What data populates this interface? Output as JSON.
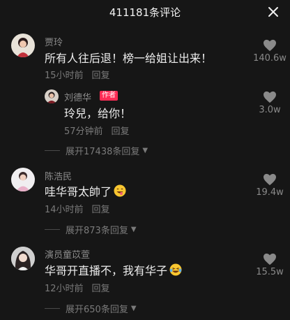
{
  "header": {
    "title": "411181条评论"
  },
  "comments": [
    {
      "username": "贾玲",
      "text": "所有人往后退！榜一给姐让出来！",
      "time": "15小时前",
      "reply_label": "回复",
      "likes": "140.6w",
      "reply": {
        "username": "刘德华",
        "author_tag": "作者",
        "text": "玲兒，给你！",
        "time": "57分钟前",
        "reply_label": "回复",
        "likes": "3.0w"
      },
      "expand_label": "展开17438条回复"
    },
    {
      "username": "陈浩民",
      "text": "哇华哥太帥了",
      "time": "14小时前",
      "reply_label": "回复",
      "likes": "19.4w",
      "expand_label": "展开873条回复"
    },
    {
      "username": "演员童苡萱",
      "text": "华哥开直播不，我有华子",
      "time": "12小时前",
      "reply_label": "回复",
      "likes": "15.5w",
      "expand_label": "展开650条回复"
    }
  ],
  "colors": {
    "background": "#161616",
    "author_tag": "#fe2c55",
    "muted": "#7a7a7a"
  }
}
